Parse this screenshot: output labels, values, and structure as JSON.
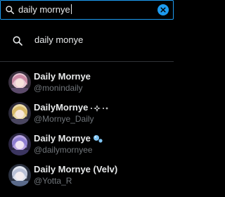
{
  "search": {
    "query": "daily mornye",
    "clear_icon": "close-icon"
  },
  "suggestion": {
    "label": "daily monye",
    "icon": "search-icon"
  },
  "users": [
    {
      "name": "Daily Mornye",
      "handle": "@monindaily",
      "avatar": "avatar-pink"
    },
    {
      "name": "DailyMornye",
      "handle": "@Mornye_Daily",
      "avatar": "avatar-blonde",
      "name_decoration": "sparkle-icons"
    },
    {
      "name": "Daily Mornye",
      "handle": "@dailymornyee",
      "avatar": "avatar-purple",
      "name_decoration": "bubbles-emoji"
    },
    {
      "name": "Daily Mornye (Velv)",
      "handle": "@Yotta_R",
      "avatar": "avatar-silver"
    }
  ],
  "colors": {
    "accent": "#1d9bf0",
    "text_primary": "#e7e9ea",
    "text_secondary": "#71767b",
    "background": "#000000",
    "divider": "#2f3336"
  }
}
